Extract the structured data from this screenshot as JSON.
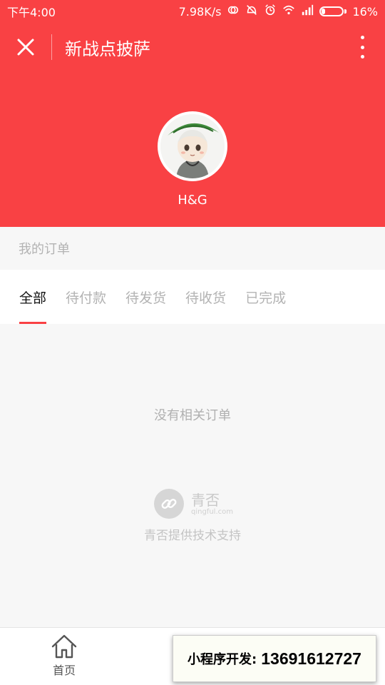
{
  "status_bar": {
    "time": "下午4:00",
    "network_speed": "7.98K/s",
    "battery": "16%",
    "icons": [
      "sync-icon",
      "alarm-off-icon",
      "alarm-icon",
      "wifi-icon",
      "signal-icon",
      "battery-icon"
    ]
  },
  "nav": {
    "title": "新战点披萨",
    "close_icon": "close-icon",
    "more_icon": "more-vertical-icon"
  },
  "profile": {
    "username": "H&G"
  },
  "orders": {
    "section_label": "我的订单",
    "tabs": [
      {
        "label": "全部",
        "active": true
      },
      {
        "label": "待付款",
        "active": false
      },
      {
        "label": "待发货",
        "active": false
      },
      {
        "label": "待收货",
        "active": false
      },
      {
        "label": "已完成",
        "active": false
      }
    ],
    "empty_text": "没有相关订单"
  },
  "brand": {
    "name": "青否",
    "domain": "qingful.com",
    "support_text": "青否提供技术支持"
  },
  "tabbar": {
    "home_label": "首页"
  },
  "promo": {
    "label": "小程序开发:",
    "phone": "13691612727"
  },
  "colors": {
    "accent": "#f94144",
    "background": "#f7f7f7"
  }
}
